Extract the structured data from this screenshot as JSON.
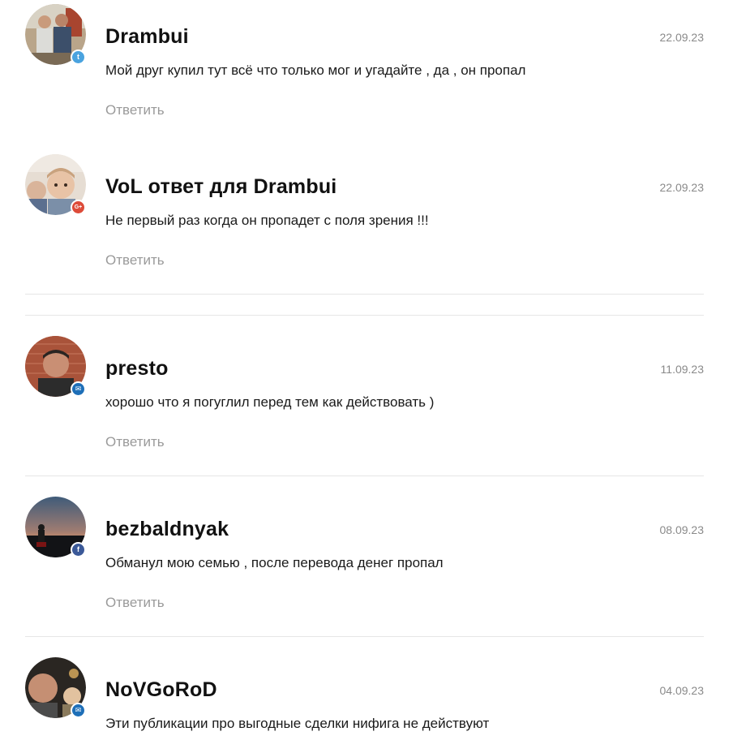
{
  "comments": [
    {
      "author": "Drambui",
      "date": "22.09.23",
      "text": "Мой друг купил тут всё что только мог и угадайте , да , он пропал",
      "reply_label": "Ответить",
      "avatar_icon": "user-photo-avatar",
      "source_icon": "twitter-icon",
      "source_color": "#4aa3df"
    },
    {
      "author": "VoL ответ для Drambui",
      "date": "22.09.23",
      "text": "Не первый раз когда он пропадет с поля зрения !!!",
      "reply_label": "Ответить",
      "avatar_icon": "user-photo-avatar",
      "source_icon": "google-plus-icon",
      "source_color": "#dd4b39"
    },
    {
      "author": "presto",
      "date": "11.09.23",
      "text": "хорошо что я погуглил перед тем как действовать )",
      "reply_label": "Ответить",
      "avatar_icon": "user-photo-avatar",
      "source_icon": "mail-icon",
      "source_color": "#1e6fb8"
    },
    {
      "author": "bezbaldnyak",
      "date": "08.09.23",
      "text": "Обманул мою семью , после перевода денег пропал",
      "reply_label": "Ответить",
      "avatar_icon": "user-photo-avatar",
      "source_icon": "facebook-icon",
      "source_color": "#3b5998"
    },
    {
      "author": "NoVGoRoD",
      "date": "04.09.23",
      "text": "Эти публикации про выгодные сделки нифига не действуют",
      "avatar_icon": "user-photo-avatar",
      "source_icon": "mail-icon",
      "source_color": "#1e6fb8"
    }
  ],
  "badges": {
    "twitter": "t",
    "gplus": "G+",
    "mail": "✉",
    "facebook": "f"
  }
}
